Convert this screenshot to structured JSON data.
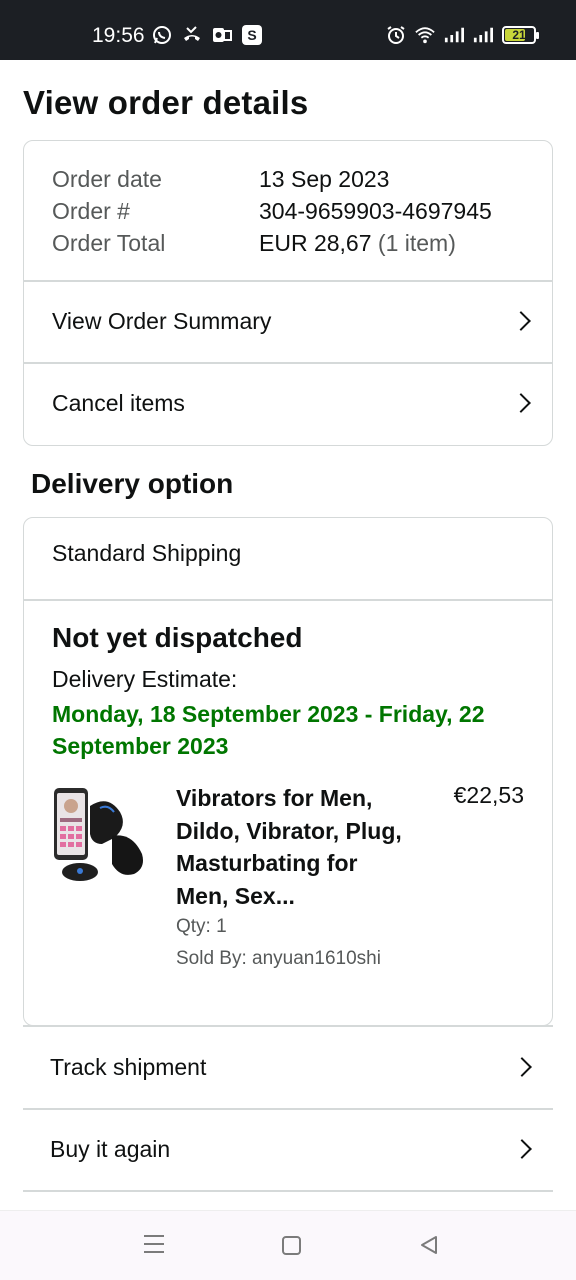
{
  "status_bar": {
    "time": "19:56",
    "left_icons": [
      "whatsapp-icon",
      "missed-call-icon",
      "outlook-icon",
      "skype-icon"
    ],
    "skype_letter": "S",
    "right_icons": [
      "alarm-icon",
      "wifi-icon",
      "signal-icon",
      "signal-icon",
      "battery-icon"
    ],
    "battery_level": "21",
    "battery_color": "#c9d63a"
  },
  "page": {
    "title": "View order details"
  },
  "order": {
    "date_label": "Order date",
    "date_value": "13 Sep 2023",
    "number_label": "Order #",
    "number_value": "304-9659903-4697945",
    "total_label": "Order Total",
    "total_value": "EUR 28,67",
    "total_items": "(1 item)",
    "links": {
      "summary": "View Order Summary",
      "cancel": "Cancel items"
    }
  },
  "delivery": {
    "section_title": "Delivery option",
    "method": "Standard Shipping",
    "status": "Not yet dispatched",
    "estimate_label": "Delivery Estimate:",
    "estimate_dates": "Monday, 18 September 2023 - Friday, 22 September 2023",
    "estimate_color": "#007600",
    "item": {
      "title": "Vibrators for Men, Dildo, Vibrator, Plug, Masturbating for Men, Sex...",
      "price": "€22,53",
      "qty": "Qty: 1",
      "sold_by": "Sold By: anyuan1610shi"
    }
  },
  "actions": {
    "track": "Track shipment",
    "buy_again": "Buy it again"
  },
  "nav_bar": {
    "icons": [
      "menu-icon",
      "home-icon",
      "back-icon"
    ]
  }
}
